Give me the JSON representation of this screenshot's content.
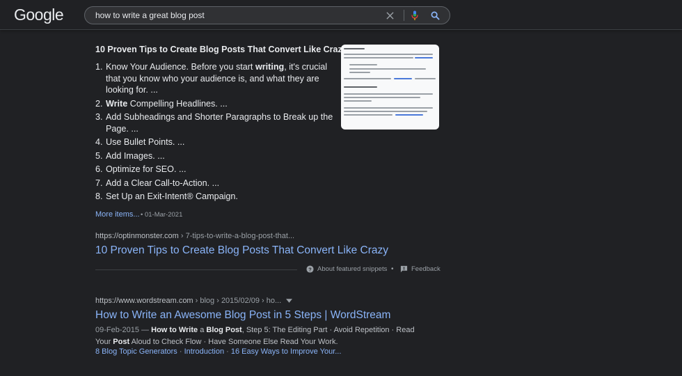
{
  "header": {
    "logo": "Google",
    "query": "how to write a great blog post"
  },
  "featured_snippet": {
    "title": "10 Proven Tips to Create Blog Posts That Convert Like Crazy",
    "items": [
      {
        "pre": "Know Your Audience. Before you start ",
        "bold": "writing",
        "post": ", it's crucial that you know who your audience is, and what they are looking for. ..."
      },
      {
        "pre": "",
        "bold": "Write",
        "post": " Compelling Headlines. ..."
      },
      {
        "pre": "Add Subheadings and Shorter Paragraphs to Break up the Page. ...",
        "bold": "",
        "post": ""
      },
      {
        "pre": "Use Bullet Points. ...",
        "bold": "",
        "post": ""
      },
      {
        "pre": "Add Images. ...",
        "bold": "",
        "post": ""
      },
      {
        "pre": "Optimize for SEO. ...",
        "bold": "",
        "post": ""
      },
      {
        "pre": "Add a Clear Call-to-Action. ...",
        "bold": "",
        "post": ""
      },
      {
        "pre": "Set Up an Exit-Intent® Campaign.",
        "bold": "",
        "post": ""
      }
    ],
    "more_items": "More items...",
    "date": "01-Mar-2021",
    "url_base": "https://optinmonster.com",
    "url_path": " › 7-tips-to-write-a-blog-post-that...",
    "link_title": "10 Proven Tips to Create Blog Posts That Convert Like Crazy",
    "about_label": "About featured snippets",
    "feedback_label": "Feedback"
  },
  "result2": {
    "url_base": "https://www.wordstream.com",
    "url_path": " › blog › 2015/02/09 › ho...",
    "title": "How to Write an Awesome Blog Post in 5 Steps | WordStream",
    "desc_date": "09-Feb-2015",
    "desc_dash": " — ",
    "desc_b1": "How to Write",
    "desc_t1": " a ",
    "desc_b2": "Blog Post",
    "desc_t2": ", Step 5: The Editing Part · Avoid Repetition · Read Your ",
    "desc_b3": "Post",
    "desc_t3": " Aloud to Check Flow · Have Someone Else Read Your Work.",
    "sitelinks": [
      "8 Blog Topic Generators",
      "Introduction",
      "16 Easy Ways to Improve Your..."
    ],
    "sitelink_sep": " · "
  },
  "icons": {
    "clear": "close-icon",
    "mic": "microphone-icon",
    "search": "search-icon",
    "help": "help-circle-icon",
    "feedback": "feedback-icon",
    "menu": "chevron-down-icon"
  },
  "colors": {
    "background": "#202124",
    "link": "#8ab4f8",
    "text": "#bdc1c6",
    "title_text": "#e8eaed"
  }
}
